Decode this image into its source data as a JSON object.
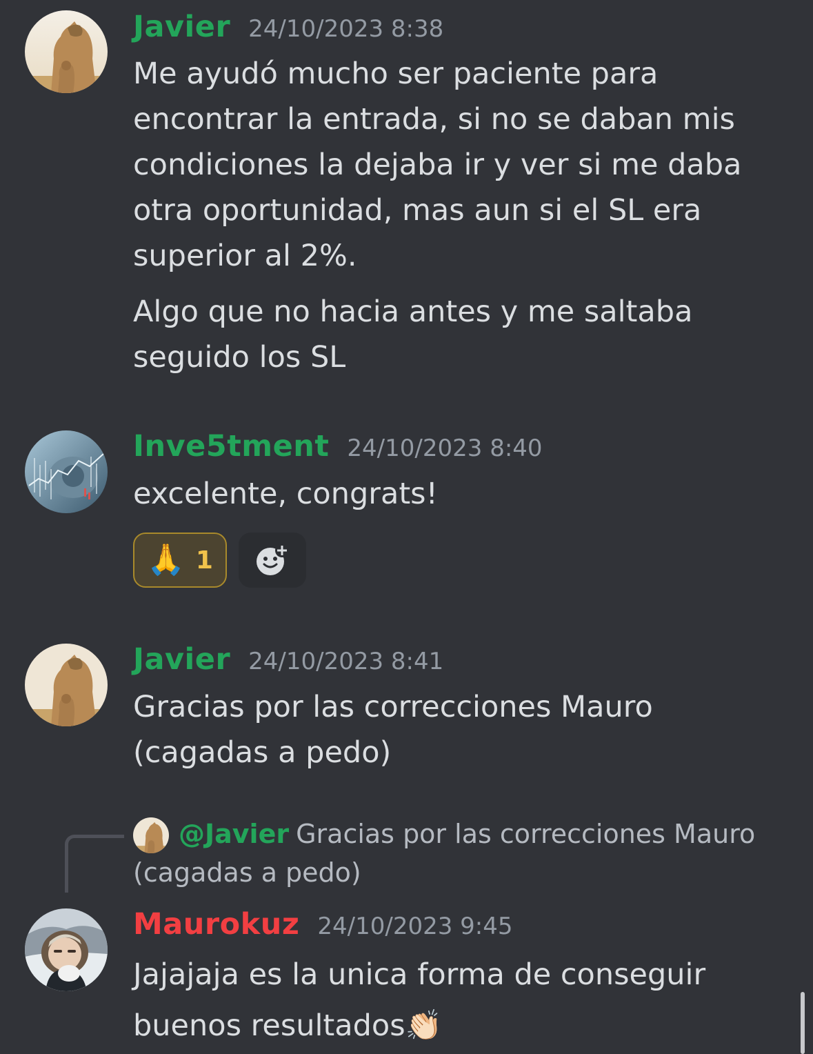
{
  "messages": [
    {
      "author": "Javier",
      "author_color": "#23a55a",
      "timestamp": "24/10/2023 8:38",
      "avatar_icon": "puma-avatar",
      "paragraphs": [
        "Me ayudó mucho ser paciente para encontrar la entrada, si no se daban mis condiciones la dejaba ir y ver si me daba otra oportunidad, mas aun si el SL era superior al 2%.",
        "Algo que no hacia antes y me saltaba seguido los SL"
      ]
    },
    {
      "author": "Inve5tment",
      "author_color": "#23a55a",
      "timestamp": "24/10/2023 8:40",
      "avatar_icon": "dollar-chart-avatar",
      "text": "excelente, congrats!",
      "reactions": [
        {
          "emoji": "🙏",
          "count": "1",
          "active": true
        }
      ],
      "add_reaction_icon": "add-reaction-icon"
    },
    {
      "author": "Javier",
      "author_color": "#23a55a",
      "timestamp": "24/10/2023 8:41",
      "avatar_icon": "puma-avatar",
      "text": "Gracias por las correcciones Mauro\n(cagadas a pedo)"
    },
    {
      "author": "Maurokuz",
      "author_color": "#f23f42",
      "timestamp": "24/10/2023 9:45",
      "avatar_icon": "person-avatar",
      "reply_to": {
        "mention": "@Javier",
        "text": "Gracias por las correcciones Mauro (cagadas a pedo)"
      },
      "text": "Jajajaja es la unica forma de conseguir buenos resultados👏🏻"
    }
  ]
}
